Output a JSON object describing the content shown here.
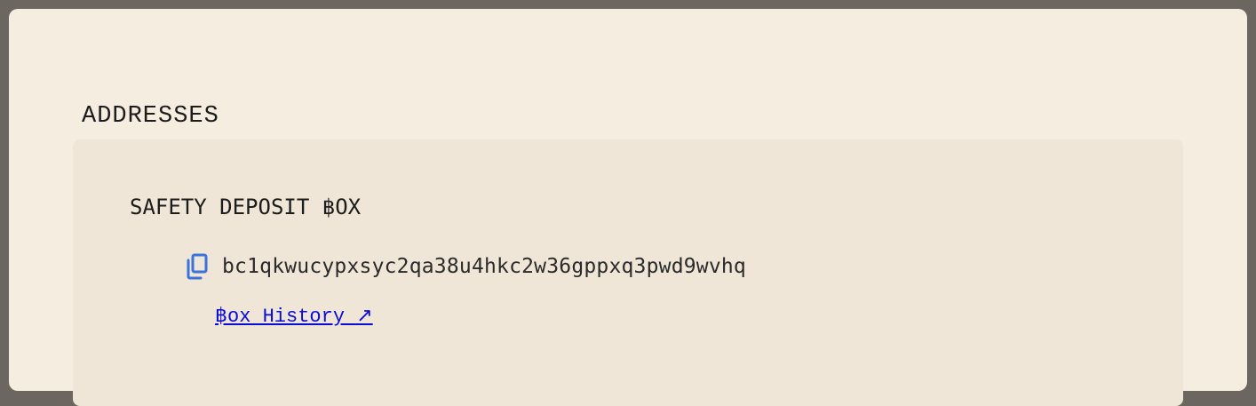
{
  "section": {
    "title": "ADDRESSES"
  },
  "box": {
    "title": "SAFETY DEPOSIT ฿OX",
    "address": "bc1qkwucypxsyc2qa38u4hkc2w36gppxq3pwd9wvhq",
    "history_link": "฿ox History ↗",
    "copy_icon": "copy-icon"
  },
  "colors": {
    "background": "#f5ede0",
    "panel": "#efe6d7",
    "icon": "#3a73d9",
    "link": "#0b0bd6"
  }
}
